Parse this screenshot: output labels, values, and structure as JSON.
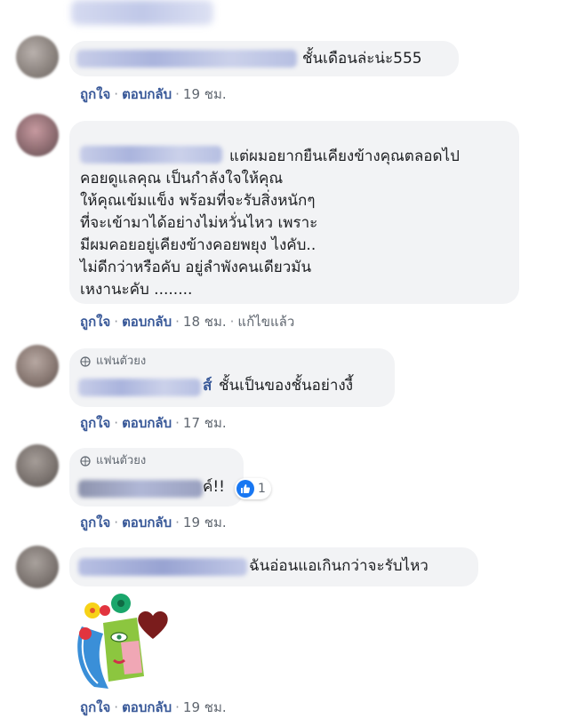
{
  "comments": [
    {
      "text": "ชั้นเดือนล่ะน่ะ555",
      "actions": {
        "like": "ถูกใจ",
        "reply": "ตอบกลับ",
        "time": "19 ชม."
      }
    },
    {
      "lines": [
        "แต่ผมอยากยืนเคียงข้างคุณตลอดไป",
        "คอยดูแลคุณ เป็นกำลังใจให้คุณ",
        "ให้คุณเข้มแข็ง พร้อมที่จะรับสิ่งหนักๆ",
        "ที่จะเข้ามาได้อย่างไม่หวั่นไหว เพราะ",
        "มีผมคอยอยู่เคียงข้างคอยพยุง ไงคับ..",
        "ไม่ดีกว่าหรือคับ อยู่ลำพังคนเดียวมัน",
        "เหงานะคับ ........"
      ],
      "actions": {
        "like": "ถูกใจ",
        "reply": "ตอบกลับ",
        "time": "18 ชม.",
        "edited": "แก้ไขแล้ว"
      }
    },
    {
      "badge": "แฟนตัวยง",
      "name_tail": "ส์",
      "text": "ชั้นเป็นของชั้นอย่างงี้",
      "actions": {
        "like": "ถูกใจ",
        "reply": "ตอบกลับ",
        "time": "17 ชม."
      }
    },
    {
      "badge": "แฟนตัวยง",
      "text": "ค์!!",
      "reaction_count": "1",
      "actions": {
        "like": "ถูกใจ",
        "reply": "ตอบกลับ",
        "time": "19 ชม."
      }
    },
    {
      "text": "ฉันอ่อนแอเกินกว่าจะรับไหว",
      "actions": {
        "like": "ถูกใจ",
        "reply": "ตอบกลับ",
        "time": "19 ชม."
      }
    }
  ],
  "colors": {
    "bubble": "#f2f3f5",
    "link": "#385898",
    "meta": "#606770",
    "like": "#1877f2"
  },
  "icons": {
    "fan_badge": "globe-icon",
    "reaction": "like-thumb-icon"
  }
}
